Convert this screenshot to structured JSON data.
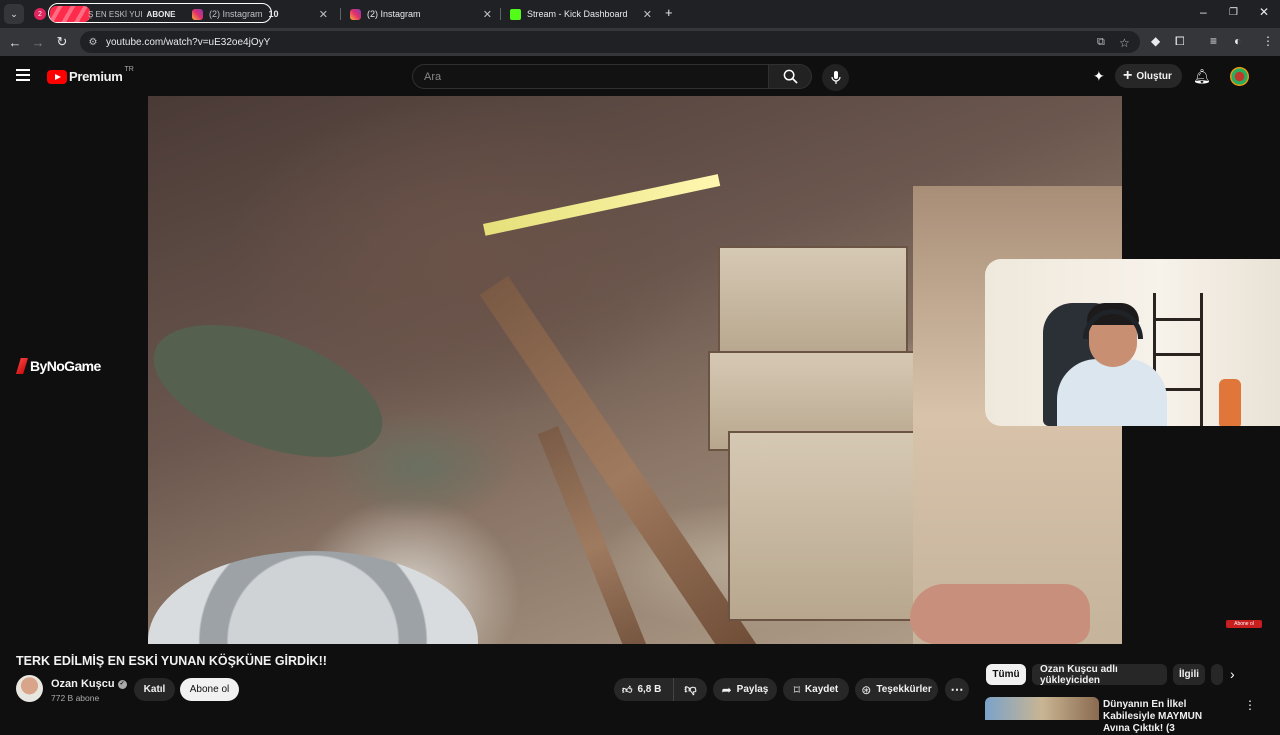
{
  "browser": {
    "tabs": [
      {
        "title": "Ş EN ESKİ YUI",
        "badge": "ABONE",
        "icon": "youtube-icon"
      },
      {
        "title": "(2) Instagram",
        "badge": "10",
        "icon": "instagram-icon"
      },
      {
        "title": "(2) Instagram",
        "icon": "instagram-icon"
      },
      {
        "title": "Stream - Kick Dashboard",
        "icon": "kick-icon"
      }
    ],
    "notif_count": "2",
    "url": "youtube.com/watch?v=uE32oe4jOyY"
  },
  "youtube": {
    "logo_text": "Premium",
    "logo_country": "TR",
    "search_placeholder": "Ara",
    "create_label": "Oluştur"
  },
  "player": {
    "brand_overlay": "ByNoGame",
    "corner_badge": "Abone ol"
  },
  "video": {
    "title": "TERK EDİLMİŞ EN ESKİ YUNAN KÖŞKÜNE GİRDİK!!",
    "channel": "Ozan Kuşcu",
    "subscribers": "772 B abone",
    "join_label": "Katıl",
    "subscribe_label": "Abone ol",
    "likes": "6,8 B",
    "share_label": "Paylaş",
    "save_label": "Kaydet",
    "thanks_label": "Teşekkürler"
  },
  "chips": [
    "Tümü",
    "Ozan Kuşcu adlı yükleyiciden",
    "İlgili"
  ],
  "recommendation": {
    "title": "Dünyanın En İlkel Kabilesiyle MAYMUN Avına Çıktık! (3"
  }
}
